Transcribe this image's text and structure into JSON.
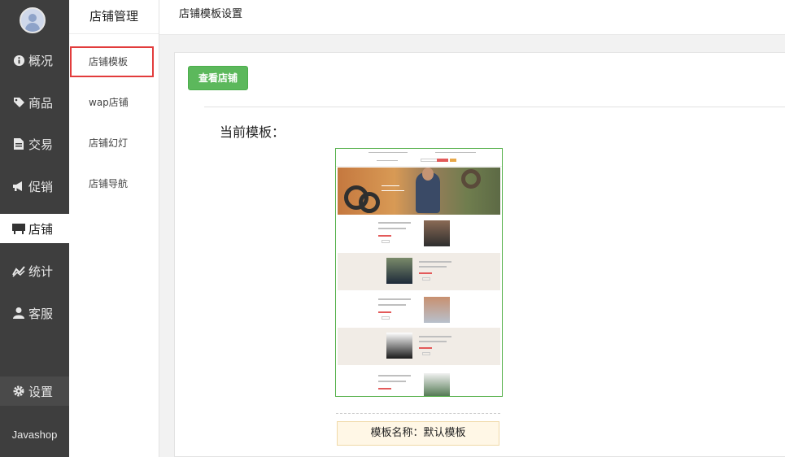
{
  "sidebar": {
    "items": [
      {
        "label": "概况",
        "icon": "info-icon"
      },
      {
        "label": "商品",
        "icon": "tag-icon"
      },
      {
        "label": "交易",
        "icon": "document-icon"
      },
      {
        "label": "促销",
        "icon": "megaphone-icon"
      },
      {
        "label": "店铺",
        "icon": "store-icon",
        "active": true
      },
      {
        "label": "统计",
        "icon": "chart-line-icon"
      },
      {
        "label": "客服",
        "icon": "user-icon"
      }
    ],
    "settings_label": "设置",
    "brand": "Javashop"
  },
  "subnav": {
    "title": "店铺管理",
    "items": [
      {
        "label": "店铺模板",
        "selected": true
      },
      {
        "label": "wap店铺"
      },
      {
        "label": "店铺幻灯"
      },
      {
        "label": "店铺导航"
      }
    ]
  },
  "header": {
    "title": "店铺模板设置"
  },
  "main": {
    "view_store_button": "查看店铺",
    "current_template_label": "当前模板：",
    "template_name": "模板名称：默认模板"
  },
  "colors": {
    "sidebar_bg": "#3e3e3e",
    "accent_green": "#5cb85c",
    "selected_outline": "#e23c3c",
    "name_box_bg": "#fff7e6"
  }
}
